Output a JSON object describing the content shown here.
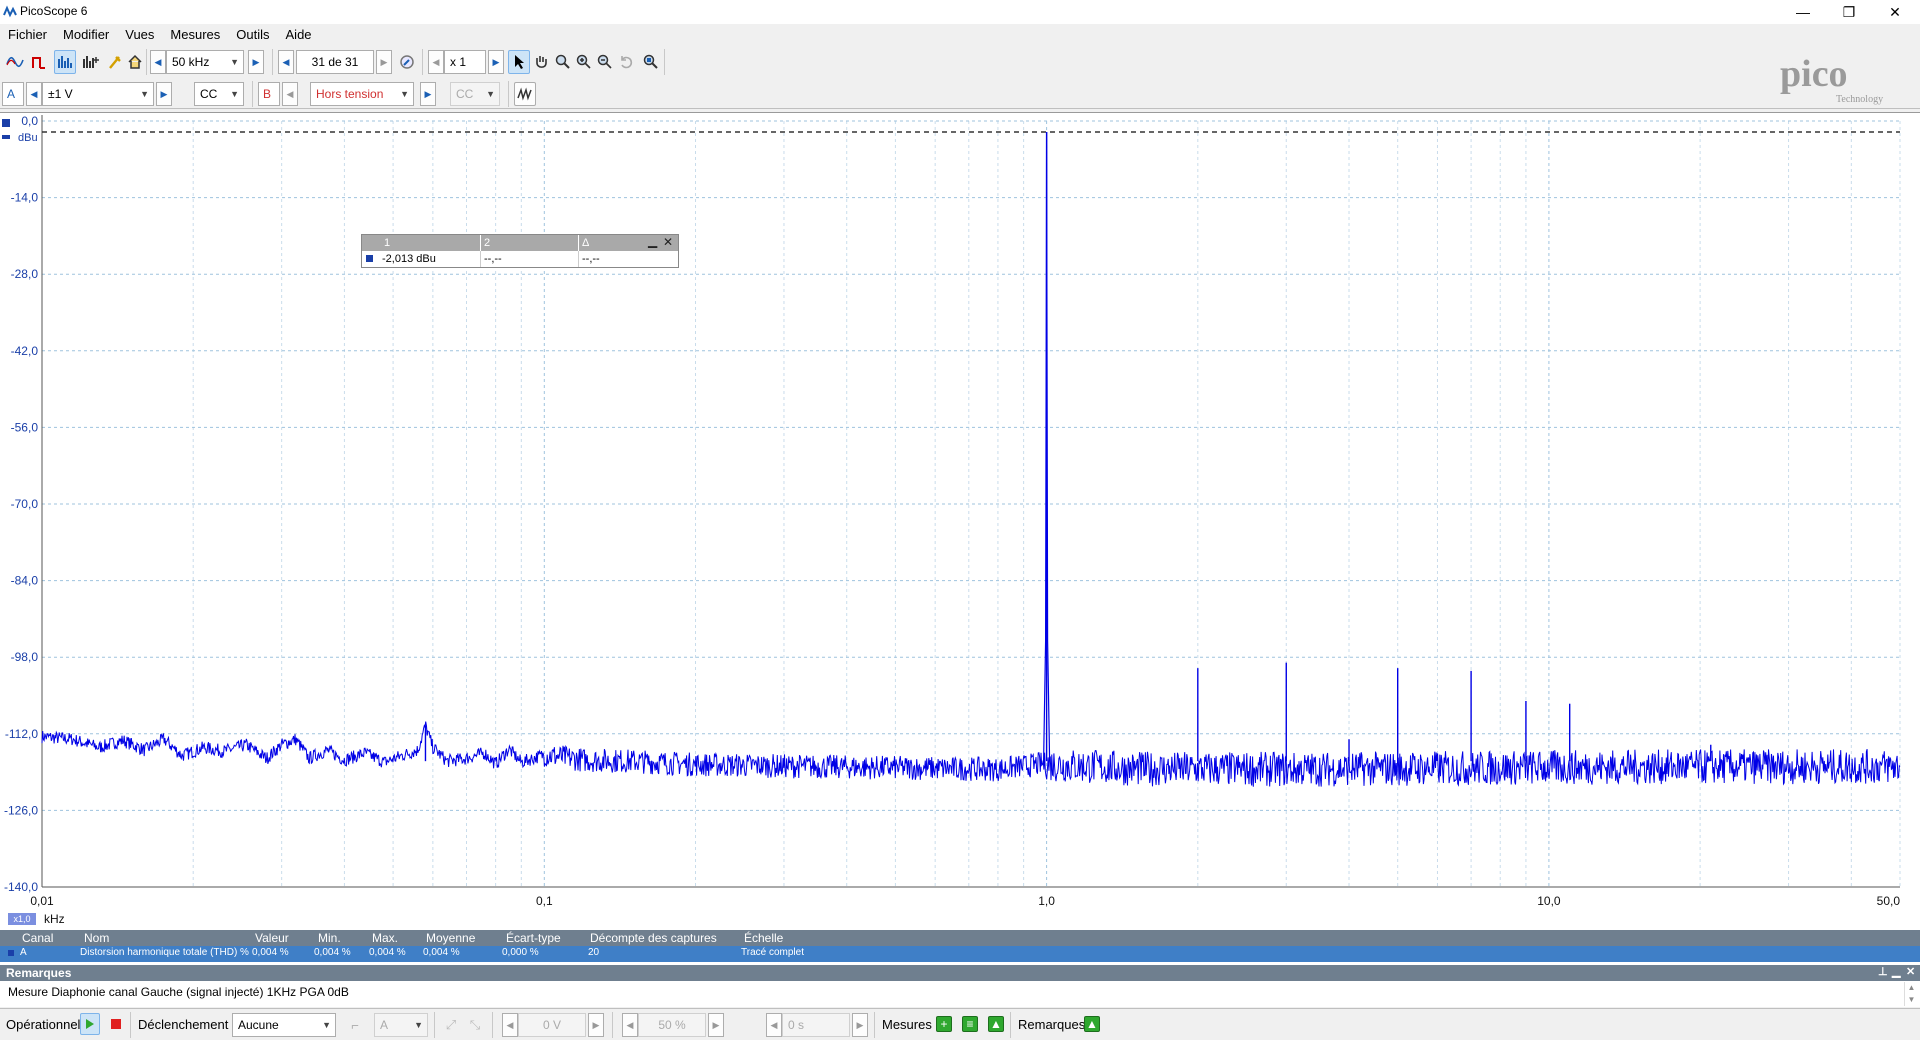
{
  "window": {
    "title": "PicoScope 6",
    "minimize": "—",
    "restore": "❐",
    "close": "✕"
  },
  "menu": [
    "Fichier",
    "Modifier",
    "Vues",
    "Mesures",
    "Outils",
    "Aide"
  ],
  "toolbar": {
    "collection_time": "50 kHz",
    "buffer_position": "31 de 31",
    "zoom_factor": "x 1"
  },
  "channels": {
    "a_label": "A",
    "a_range": "±1 V",
    "a_coupling": "CC",
    "b_label": "B",
    "b_range": "Hors tension",
    "b_coupling": "CC"
  },
  "brand": {
    "name": "pico",
    "sub": "Technology"
  },
  "chart_data": {
    "type": "line",
    "title": "",
    "xlabel": "kHz",
    "ylabel": "dBu",
    "x_scale": "log",
    "xlim": [
      0.01,
      50.0
    ],
    "ylim": [
      -140.0,
      0.0
    ],
    "x_ticks": [
      "0,01",
      "0,1",
      "1,0",
      "10,0",
      "50,0"
    ],
    "y_ticks": [
      "0,0",
      "-14,0",
      "-28,0",
      "-42,0",
      "-56,0",
      "-70,0",
      "-84,0",
      "-98,0",
      "-112,0",
      "-126,0",
      "-140,0"
    ],
    "grid": true,
    "reference_line_db": -2.0,
    "noise_floor": [
      [
        0.01,
        -112.5
      ],
      [
        0.0115,
        -113.0
      ],
      [
        0.013,
        -114.5
      ],
      [
        0.0145,
        -113.2
      ],
      [
        0.016,
        -115.0
      ],
      [
        0.0175,
        -113.0
      ],
      [
        0.019,
        -116.0
      ],
      [
        0.021,
        -114.5
      ],
      [
        0.023,
        -115.2
      ],
      [
        0.0255,
        -114.0
      ],
      [
        0.028,
        -116.5
      ],
      [
        0.03,
        -114.0
      ],
      [
        0.032,
        -113.0
      ],
      [
        0.034,
        -116.5
      ],
      [
        0.037,
        -115.0
      ],
      [
        0.04,
        -116.8
      ],
      [
        0.044,
        -115.5
      ],
      [
        0.048,
        -117.2
      ],
      [
        0.052,
        -116.0
      ],
      [
        0.056,
        -115.0
      ],
      [
        0.058,
        -110.5
      ],
      [
        0.06,
        -114.5
      ],
      [
        0.064,
        -117.0
      ],
      [
        0.07,
        -116.5
      ],
      [
        0.076,
        -115.5
      ],
      [
        0.08,
        -117.5
      ],
      [
        0.085,
        -114.8
      ],
      [
        0.09,
        -117.2
      ],
      [
        0.1,
        -115.8
      ],
      [
        0.12,
        -116.8
      ],
      [
        0.15,
        -117.0
      ],
      [
        0.2,
        -117.6
      ],
      [
        0.3,
        -117.9
      ],
      [
        0.5,
        -118.2
      ],
      [
        0.8,
        -118.5
      ],
      [
        0.98,
        -117.5
      ],
      [
        1.5,
        -118.4
      ],
      [
        3.0,
        -118.5
      ],
      [
        6.0,
        -118.3
      ],
      [
        12.0,
        -118.1
      ],
      [
        25.0,
        -118.0
      ],
      [
        50.0,
        -118.0
      ]
    ],
    "peaks": [
      {
        "x": 0.058,
        "y": -110.5
      },
      {
        "x": 1.0,
        "y": -2.013
      },
      {
        "x": 2.0,
        "y": -100.0
      },
      {
        "x": 3.0,
        "y": -99.0
      },
      {
        "x": 4.0,
        "y": -113.0
      },
      {
        "x": 5.0,
        "y": -100.0
      },
      {
        "x": 7.0,
        "y": -100.5
      },
      {
        "x": 9.0,
        "y": -106.0
      },
      {
        "x": 11.0,
        "y": -106.5
      },
      {
        "x": 21.0,
        "y": -114.0
      }
    ],
    "series_color": "#0000e6"
  },
  "ruler_table": {
    "headers": [
      "1",
      "2",
      "Δ"
    ],
    "values": [
      "-2,013 dBu",
      "--,--",
      "--,--"
    ]
  },
  "measurements": {
    "headers": [
      "Canal",
      "Nom",
      "Valeur",
      "Min.",
      "Max.",
      "Moyenne",
      "Écart-type",
      "Décompte des captures",
      "Échelle"
    ],
    "row": [
      "A",
      "Distorsion harmonique totale (THD) %",
      "0,004 %",
      "0,004 %",
      "0,004 %",
      "0,004 %",
      "0,000 %",
      "20",
      "Tracé complet"
    ]
  },
  "remarks": {
    "title": "Remarques",
    "text": "Mesure Diaphonie canal Gauche (signal injecté) 1KHz PGA 0dB"
  },
  "bottom": {
    "status": "Opérationnel",
    "trigger_label": "Déclenchement",
    "trigger_mode": "Aucune",
    "trigger_source": "A",
    "threshold": "0 V",
    "pretrigger": "50 %",
    "delay": "0 s",
    "measures_label": "Mesures",
    "remarks_label": "Remarques"
  },
  "x_multiplier": "x1,0"
}
